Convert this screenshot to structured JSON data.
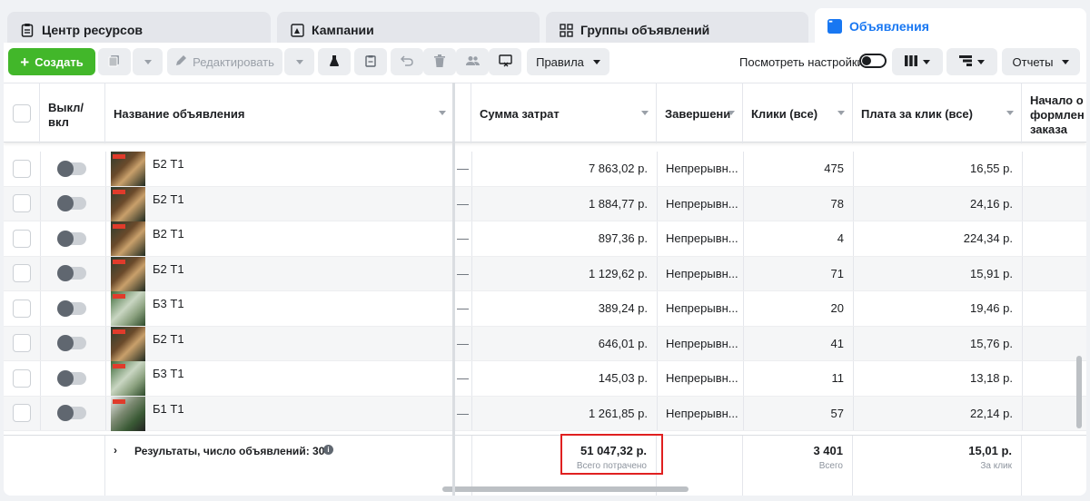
{
  "tabs": [
    {
      "label": "Центр ресурсов",
      "icon": "clipboard-icon"
    },
    {
      "label": "Кампании",
      "icon": "flag-icon"
    },
    {
      "label": "Группы объявлений",
      "icon": "grid-icon"
    },
    {
      "label": "Объявления",
      "icon": "ad-icon",
      "active": true
    }
  ],
  "toolbar": {
    "create_label": "Создать",
    "edit_label": "Редактировать",
    "rules_label": "Правила",
    "view_settings_label": "Посмотреть настройки",
    "reports_label": "Отчеты"
  },
  "columns": {
    "toggle": "Выкл/ вкл",
    "name": "Название объявления",
    "spend": "Сумма затрат",
    "delivery": "Завершени",
    "clicks": "Клики (все)",
    "cpc": "Плата за клик (все)",
    "checkout": "Начало оформлен заказа"
  },
  "rows": [
    {
      "name": "Б2 Т1",
      "dash": "—",
      "spend": "7 863,02 р.",
      "delivery": "Непрерывн...",
      "clicks": "475",
      "cpc": "16,55 р.",
      "thumb": "b"
    },
    {
      "name": "Б2 Т1",
      "dash": "—",
      "spend": "1 884,77 р.",
      "delivery": "Непрерывн...",
      "clicks": "78",
      "cpc": "24,16 р.",
      "thumb": "b"
    },
    {
      "name": "В2 Т1",
      "dash": "—",
      "spend": "897,36 р.",
      "delivery": "Непрерывн...",
      "clicks": "4",
      "cpc": "224,34 р.",
      "thumb": "b"
    },
    {
      "name": "Б2 Т1",
      "dash": "—",
      "spend": "1 129,62 р.",
      "delivery": "Непрерывн...",
      "clicks": "71",
      "cpc": "15,91 р.",
      "thumb": "b"
    },
    {
      "name": "Б3 Т1",
      "dash": "—",
      "spend": "389,24 р.",
      "delivery": "Непрерывн...",
      "clicks": "20",
      "cpc": "19,46 р.",
      "thumb": "g"
    },
    {
      "name": "Б2 Т1",
      "dash": "—",
      "spend": "646,01 р.",
      "delivery": "Непрерывн...",
      "clicks": "41",
      "cpc": "15,76 р.",
      "thumb": "b"
    },
    {
      "name": "Б3 Т1",
      "dash": "—",
      "spend": "145,03 р.",
      "delivery": "Непрерывн...",
      "clicks": "11",
      "cpc": "13,18 р.",
      "thumb": "g"
    },
    {
      "name": "Б1 Т1",
      "dash": "—",
      "spend": "1 261,85 р.",
      "delivery": "Непрерывн...",
      "clicks": "57",
      "cpc": "22,14 р.",
      "thumb": "w"
    }
  ],
  "footer": {
    "results_label": "Результаты, число объявлений: 30",
    "total_spend": "51 047,32 р.",
    "total_spend_sub": "Всего потрачено",
    "total_clicks": "3 401",
    "total_clicks_sub": "Всего",
    "avg_cpc": "15,01 р.",
    "avg_cpc_sub": "За клик"
  },
  "colors": {
    "accent": "#1877f2",
    "create_button": "#42b72a",
    "highlight_box": "#e02020"
  }
}
